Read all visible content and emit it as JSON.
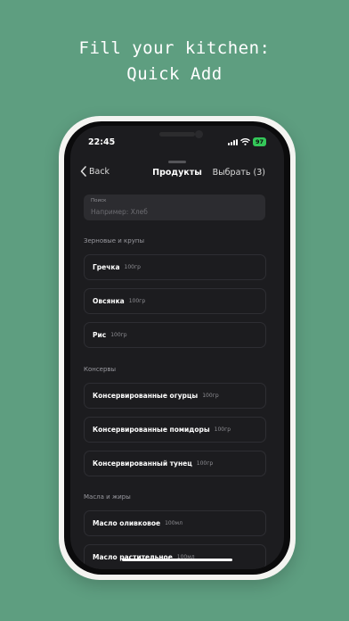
{
  "headline": {
    "line1": "Fill your kitchen:",
    "line2": "Quick Add"
  },
  "status_bar": {
    "time": "22:45",
    "battery": "97"
  },
  "nav": {
    "back_label": "Back",
    "title": "Продукты",
    "select_label": "Выбрать (3)"
  },
  "search": {
    "label": "Поиск",
    "placeholder": "Например: Хлеб"
  },
  "sections": [
    {
      "title": "Зерновые и крупы",
      "items": [
        {
          "name": "Гречка",
          "qty": "100гр"
        },
        {
          "name": "Овсянка",
          "qty": "100гр"
        },
        {
          "name": "Рис",
          "qty": "100гр"
        }
      ]
    },
    {
      "title": "Консервы",
      "items": [
        {
          "name": "Консервированные огурцы",
          "qty": "100гр"
        },
        {
          "name": "Консервированные помидоры",
          "qty": "100гр"
        },
        {
          "name": "Консервированный тунец",
          "qty": "100гр"
        }
      ]
    },
    {
      "title": "Масла и жиры",
      "items": [
        {
          "name": "Масло оливковое",
          "qty": "100мл"
        },
        {
          "name": "Масло растительное",
          "qty": "100мл"
        }
      ]
    }
  ],
  "colors": {
    "background": "#5e9e80",
    "screen": "#1c1c1f",
    "battery": "#34c759"
  },
  "icons": [
    "chevron-left-icon",
    "signal-icon",
    "wifi-icon",
    "battery-icon"
  ]
}
